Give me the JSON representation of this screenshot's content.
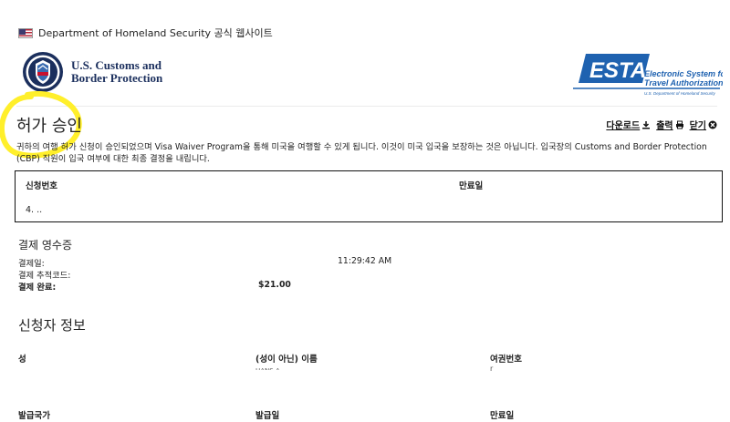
{
  "banner": {
    "text": "Department of Homeland Security 공식 웹사이트",
    "flag_icon": "us-flag-icon"
  },
  "cbp": {
    "line1": "U.S. Customs and",
    "line2": "Border Protection"
  },
  "esta": {
    "logo_text": "ESTA",
    "line1": "Electronic System for",
    "line2": "Travel Authorization",
    "line3": "U.S. Department of Homeland Security"
  },
  "page": {
    "title": "허가 승인",
    "highlight_color": "#ffef2b"
  },
  "actions": {
    "download": "다운로드",
    "print": "출력",
    "close": "닫기"
  },
  "intro": "귀하의 여행 허가 신청이 승인되었으며 Visa Waiver Program을 통해 미국을 여행할 수 있게 됩니다. 이것이 미국 입국을 보장하는 것은 아닙니다. 입국장의 Customs and Border Protection (CBP) 직원이 입국 여부에 대한 최종 결정을 내립니다.",
  "application": {
    "number_label": "신청번호",
    "expiry_label": "만료일",
    "number_value": "4. .."
  },
  "payment": {
    "heading": "결제 영수증",
    "date_label": "결제일:",
    "tracking_label": "결제 추적코드:",
    "complete_label": "결제 완료:",
    "date_value": "11:29:42 AM",
    "amount": "$21.00"
  },
  "applicant": {
    "heading": "신청자 정보",
    "surname_label": "성",
    "given_label": "(성이 아닌) 이름",
    "passport_label": "여권번호",
    "issuing_country_label": "발급국가",
    "issue_date_label": "발급일",
    "expiry_label": "만료일",
    "given_value": "HANS A",
    "passport_value": "r"
  },
  "colors": {
    "brand_navy": "#1b2f5d",
    "esta_blue": "#1f62b0",
    "text": "#222222"
  }
}
